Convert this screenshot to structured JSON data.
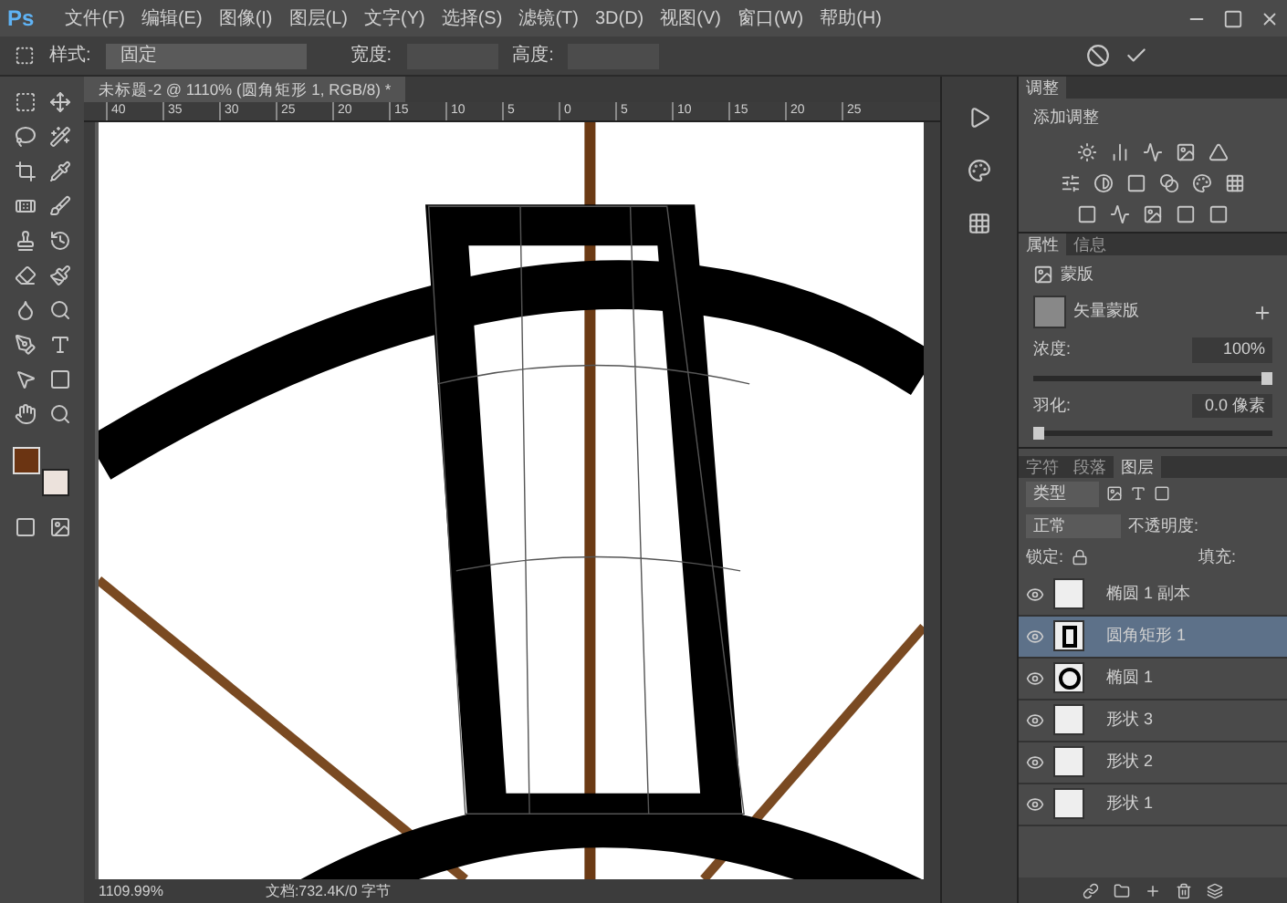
{
  "app": {
    "logo": "Ps"
  },
  "menu": [
    "文件(F)",
    "编辑(E)",
    "图像(I)",
    "图层(L)",
    "文字(Y)",
    "选择(S)",
    "滤镜(T)",
    "3D(D)",
    "视图(V)",
    "窗口(W)",
    "帮助(H)"
  ],
  "options": {
    "style_label": "样式:",
    "style_value": "固定",
    "width_label": "宽度:",
    "height_label": "高度:"
  },
  "document_tab": {
    "title": "未标题-2 @ 1110% (圆角矩形 1, RGB/8) *"
  },
  "ruler_ticks": [
    "40",
    "35",
    "30",
    "25",
    "20",
    "15",
    "10",
    "5",
    "0",
    "5",
    "10",
    "15",
    "20",
    "25"
  ],
  "adjustments": {
    "tab": "调整",
    "heading": "添加调整"
  },
  "properties": {
    "tabs": [
      {
        "label": "属性",
        "selected": true
      },
      {
        "label": "信息",
        "selected": false
      }
    ],
    "mask_label": "蒙版",
    "vector_mask": "矢量蒙版",
    "density": {
      "label": "浓度:",
      "value": "100%",
      "level": 1
    },
    "feather": {
      "label": "羽化:",
      "value": "0.0 像素",
      "level": 0
    }
  },
  "layers_panel": {
    "tabs": [
      {
        "label": "字符",
        "selected": false
      },
      {
        "label": "段落",
        "selected": false
      },
      {
        "label": "图层",
        "selected": true
      }
    ],
    "filter": "类型",
    "blend": "正常",
    "opacity_label": "不透明度:",
    "lock_label": "锁定:",
    "fill_label": "填充:",
    "layers": [
      {
        "name": "椭圆 1 副本",
        "visible": true,
        "selected": false,
        "kind": "shape"
      },
      {
        "name": "圆角矩形 1",
        "visible": true,
        "selected": true,
        "kind": "rect"
      },
      {
        "name": "椭圆 1",
        "visible": true,
        "selected": false,
        "kind": "ellipse"
      },
      {
        "name": "形状 3",
        "visible": true,
        "selected": false,
        "kind": "shape"
      },
      {
        "name": "形状 2",
        "visible": true,
        "selected": false,
        "kind": "shape"
      },
      {
        "name": "形状 1",
        "visible": true,
        "selected": false,
        "kind": "shape"
      }
    ]
  },
  "status": {
    "zoom": "1109.99%",
    "doc": "文档:732.4K/0 字节"
  }
}
